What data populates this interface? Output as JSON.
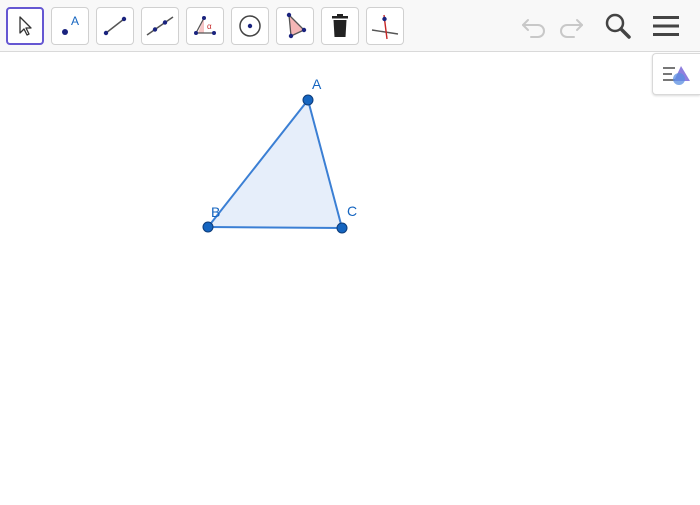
{
  "toolbar": {
    "tools": [
      {
        "name": "move-tool",
        "icon": "arrow-cursor-icon",
        "selected": true
      },
      {
        "name": "point-tool",
        "icon": "point-icon",
        "label": "A"
      },
      {
        "name": "segment-tool",
        "icon": "segment-icon"
      },
      {
        "name": "line-tool",
        "icon": "line-icon"
      },
      {
        "name": "angle-tool",
        "icon": "angle-icon",
        "label": "α"
      },
      {
        "name": "circle-tool",
        "icon": "circle-with-center-icon"
      },
      {
        "name": "polygon-tool",
        "icon": "polygon-icon"
      },
      {
        "name": "delete-tool",
        "icon": "trash-icon"
      },
      {
        "name": "perpendicular-line-tool",
        "icon": "perpendicular-line-icon"
      }
    ],
    "undo_icon": "undo-icon",
    "redo_icon": "redo-icon",
    "search_icon": "search-icon",
    "menu_icon": "hamburger-menu-icon"
  },
  "construction": {
    "points": [
      {
        "label": "A"
      },
      {
        "label": "B"
      },
      {
        "label": "C"
      }
    ],
    "polygon_fill": "#e6eefa",
    "stroke_color": "#3b7fd4",
    "point_color": "#1565c0"
  },
  "algebra_toggle_icon": "algebra-view-toggle-icon",
  "colors": {
    "selected_border": "#6557d2",
    "toolbar_bg": "#f8f8f8",
    "icon_dark": "#333333",
    "accent_blue": "#1565c0"
  }
}
